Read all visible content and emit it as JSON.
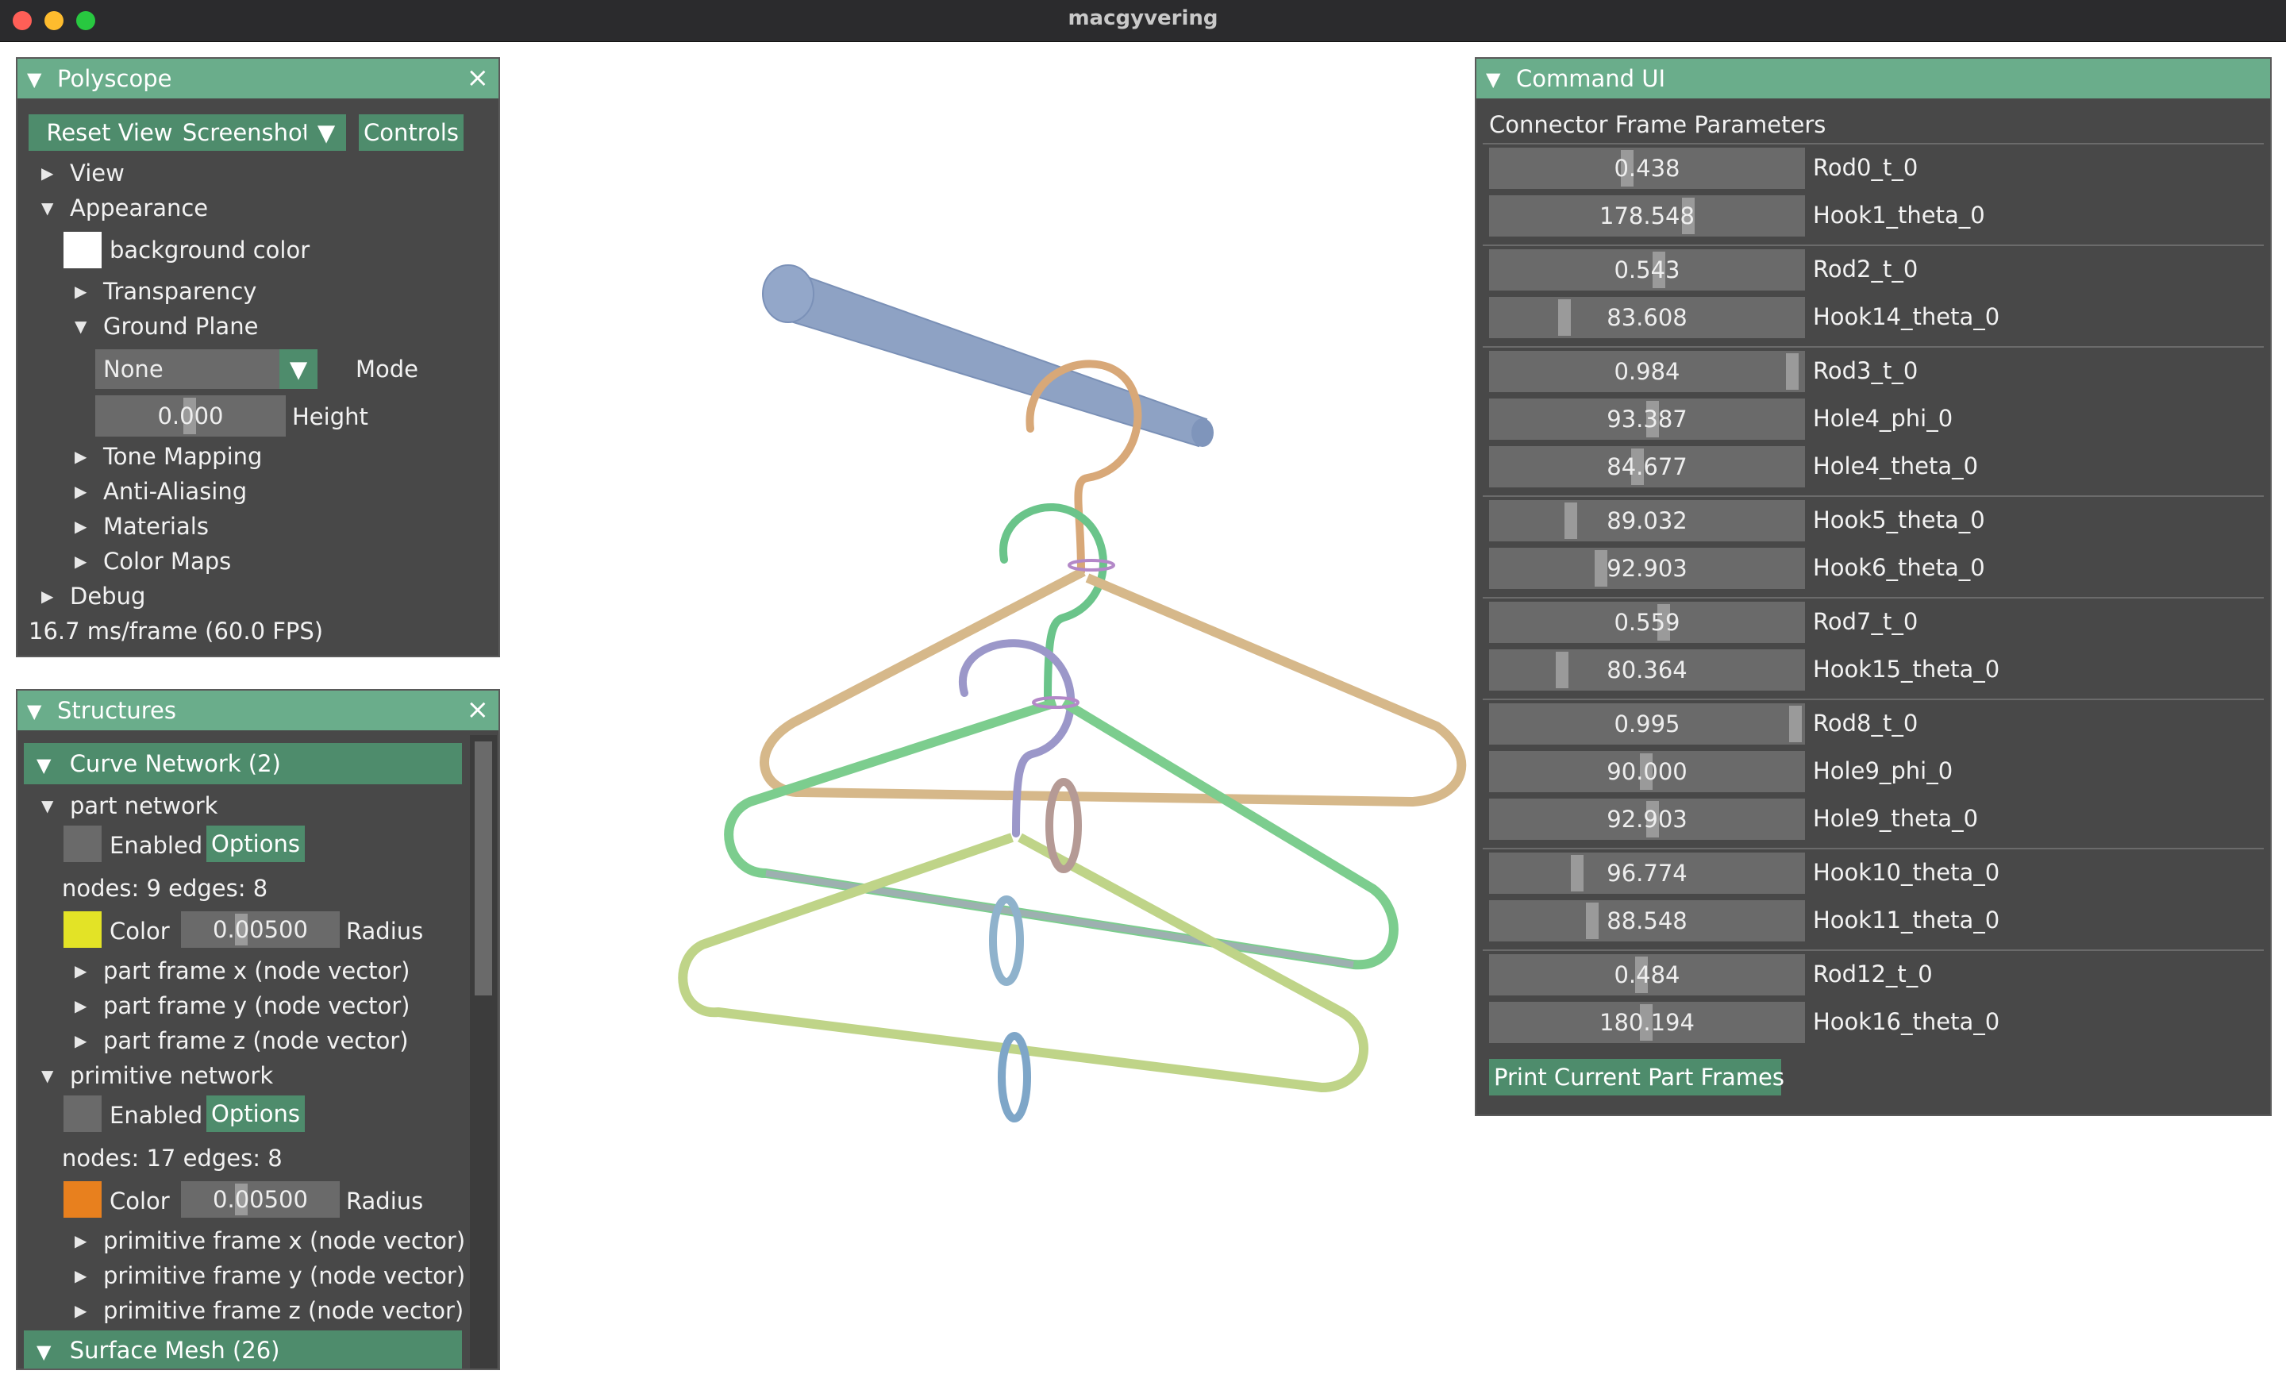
{
  "window": {
    "title": "macgyvering",
    "traffic_colors": [
      "#ff5f57",
      "#febc2e",
      "#28c840"
    ]
  },
  "polyscope": {
    "title": "Polyscope",
    "buttons": {
      "reset": "Reset View",
      "screenshot": "Screenshot",
      "controls": "Controls"
    },
    "tree": {
      "view": "View",
      "appearance": "Appearance",
      "background_color": "background color",
      "transparency": "Transparency",
      "ground_plane": "Ground Plane",
      "mode_value": "None",
      "mode_label": "Mode",
      "height_value": "0.000",
      "height_level": 0.5,
      "height_label": "Height",
      "tone_mapping": "Tone Mapping",
      "anti_aliasing": "Anti-Aliasing",
      "materials": "Materials",
      "color_maps": "Color Maps",
      "debug": "Debug"
    },
    "fps": "16.7 ms/frame (60.0 FPS)"
  },
  "structures": {
    "title": "Structures",
    "curve_network": "Curve Network (2)",
    "part": {
      "name": "part network",
      "enabled": "Enabled",
      "options": "Options",
      "stats": "nodes: 9  edges: 8",
      "color_label": "Color",
      "color": "#e3e326",
      "radius_value": "0.00500",
      "radius_label": "Radius",
      "fx": "part frame x (node vector)",
      "fy": "part frame y (node vector)",
      "fz": "part frame z (node vector)"
    },
    "primitive": {
      "name": "primitive network",
      "enabled": "Enabled",
      "options": "Options",
      "stats": "nodes: 17  edges: 8",
      "color_label": "Color",
      "color": "#e8801e",
      "radius_value": "0.00500",
      "radius_label": "Radius",
      "fx": "primitive frame x (node vector)",
      "fy": "primitive frame y (node vector)",
      "fz": "primitive frame z (node vector)"
    },
    "surface_mesh": "Surface Mesh (26)"
  },
  "command_ui": {
    "title": "Command UI",
    "heading": "Connector Frame Parameters",
    "groups": [
      [
        {
          "value": "0.438",
          "label": "Rod0_t_0",
          "level": 0.438
        },
        {
          "value": "178.548",
          "label": "Hook1_theta_0",
          "level": 0.64
        }
      ],
      [
        {
          "value": "0.543",
          "label": "Rod2_t_0",
          "level": 0.543
        },
        {
          "value": "83.608",
          "label": "Hook14_theta_0",
          "level": 0.23
        }
      ],
      [
        {
          "value": "0.984",
          "label": "Rod3_t_0",
          "level": 0.984
        },
        {
          "value": "93.387",
          "label": "Hole4_phi_0",
          "level": 0.52
        },
        {
          "value": "84.677",
          "label": "Hole4_theta_0",
          "level": 0.47
        }
      ],
      [
        {
          "value": "89.032",
          "label": "Hook5_theta_0",
          "level": 0.25
        },
        {
          "value": "92.903",
          "label": "Hook6_theta_0",
          "level": 0.35
        }
      ],
      [
        {
          "value": "0.559",
          "label": "Rod7_t_0",
          "level": 0.559
        },
        {
          "value": "80.364",
          "label": "Hook15_theta_0",
          "level": 0.22
        }
      ],
      [
        {
          "value": "0.995",
          "label": "Rod8_t_0",
          "level": 0.995
        },
        {
          "value": "90.000",
          "label": "Hole9_phi_0",
          "level": 0.5
        },
        {
          "value": "92.903",
          "label": "Hole9_theta_0",
          "level": 0.52
        }
      ],
      [
        {
          "value": "96.774",
          "label": "Hook10_theta_0",
          "level": 0.27
        },
        {
          "value": "88.548",
          "label": "Hook11_theta_0",
          "level": 0.32
        }
      ],
      [
        {
          "value": "0.484",
          "label": "Rod12_t_0",
          "level": 0.484
        },
        {
          "value": "180.194",
          "label": "Hook16_theta_0",
          "level": 0.5
        }
      ]
    ],
    "print_button": "Print Current Part Frames"
  }
}
